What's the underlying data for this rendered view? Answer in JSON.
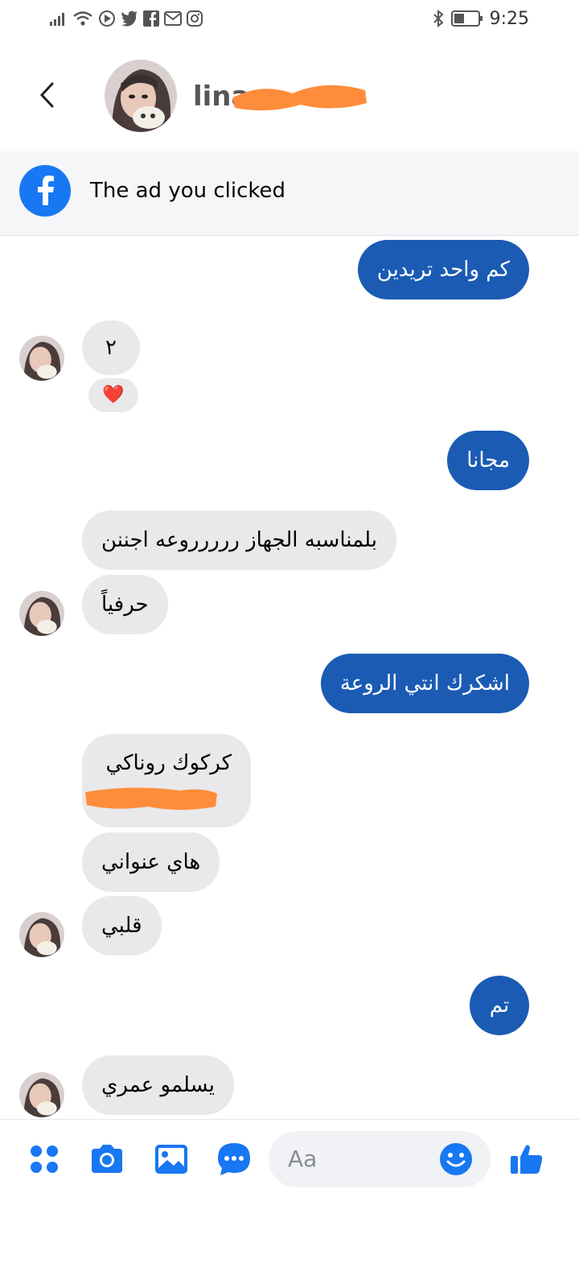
{
  "status_bar": {
    "time": "9:25",
    "left_icons": [
      "signal-icon",
      "wifi-icon",
      "play-icon",
      "twitter-icon",
      "facebook-icon",
      "gmail-icon",
      "instagram-icon"
    ],
    "right_icons": [
      "bluetooth-icon",
      "battery-icon"
    ]
  },
  "header": {
    "contact_name": "lina"
  },
  "ad_banner": {
    "label": "The ad you clicked",
    "icon": "facebook-icon"
  },
  "messages": [
    {
      "sender": "me",
      "text": "كم واحد تريدين"
    },
    {
      "sender": "them",
      "text": "٢"
    },
    {
      "sender": "them",
      "text": "❤️"
    },
    {
      "sender": "me",
      "text": "مجانا"
    },
    {
      "sender": "them",
      "text": "بلمناسبه الجهاز ررررروعه اجننن"
    },
    {
      "sender": "them",
      "text": "حرفياً"
    },
    {
      "sender": "me",
      "text": "اشكرك انتي الروعة"
    },
    {
      "sender": "them",
      "text": "كركوك روناكي"
    },
    {
      "sender": "them",
      "text": "هاي عنواني"
    },
    {
      "sender": "them",
      "text": "قلبي"
    },
    {
      "sender": "me",
      "text": "تم"
    },
    {
      "sender": "them",
      "text": "يسلمو عمري"
    }
  ],
  "composer": {
    "placeholder": "Aa",
    "icons": [
      "apps-icon",
      "camera-icon",
      "gallery-icon",
      "chat-bubble-icon",
      "emoji-icon",
      "like-icon"
    ]
  },
  "colors": {
    "outgoing_bubble": "#1b5bb4",
    "incoming_bubble": "#e9e9eb",
    "accent": "#1877f2",
    "redaction": "#ff8c3a"
  }
}
